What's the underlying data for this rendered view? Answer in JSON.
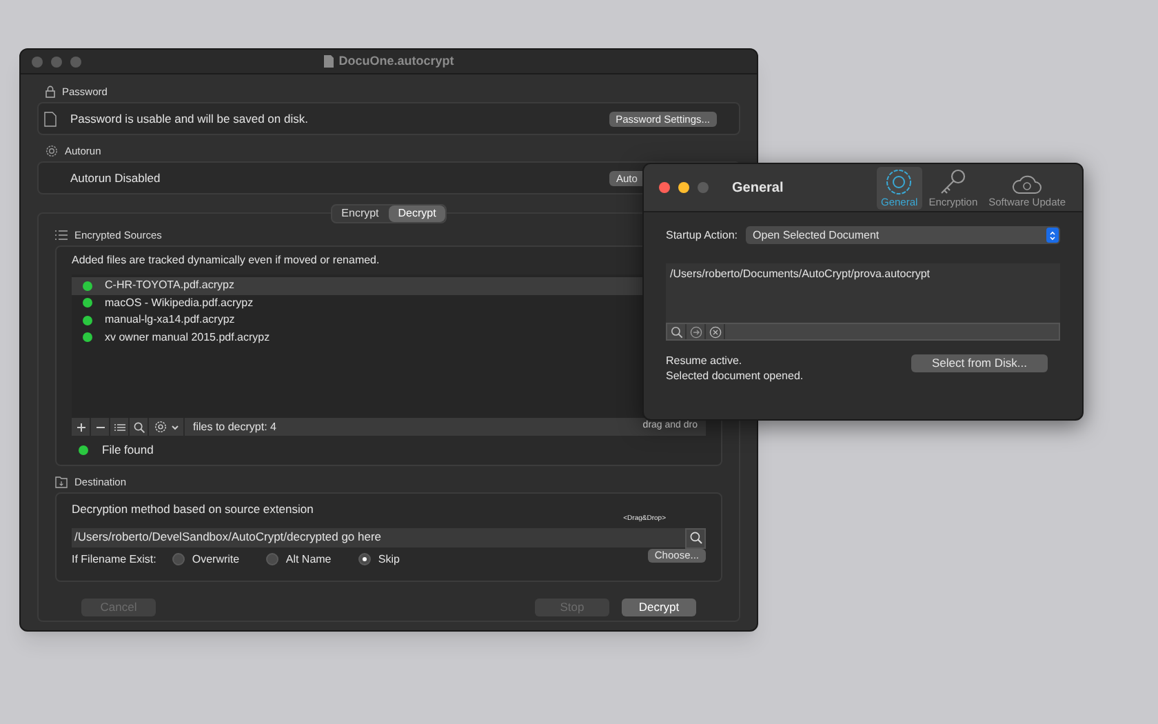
{
  "main_window": {
    "title": "DocuOne.autocrypt",
    "password": {
      "heading": "Password",
      "message": "Password is usable and will be saved on disk.",
      "button": "Password Settings..."
    },
    "autorun": {
      "heading": "Autorun",
      "message": "Autorun Disabled",
      "button": "Auto"
    },
    "mode_tabs": [
      {
        "label": "Encrypt",
        "selected": false
      },
      {
        "label": "Decrypt",
        "selected": true
      }
    ],
    "sources": {
      "heading": "Encrypted Sources",
      "note": "Added files are tracked dynamically  even if moved or renamed.",
      "files": [
        {
          "name": "C-HR-TOYOTA.pdf.acrypz",
          "selected": true,
          "color": "#2ac840"
        },
        {
          "name": "macOS - Wikipedia.pdf.acrypz",
          "selected": false,
          "color": "#2ac840"
        },
        {
          "name": "manual-lg-xa14.pdf.acrypz",
          "selected": false,
          "color": "#2ac840"
        },
        {
          "name": "xv owner manual 2015.pdf.acrypz",
          "selected": false,
          "color": "#2ac840"
        }
      ],
      "count": "files to decrypt: 4",
      "drop_hint": "drag and dro",
      "status": {
        "text": "File found",
        "color": "#2ac840"
      }
    },
    "destination": {
      "heading": "Destination",
      "note": "Decryption method based on source extension",
      "drop_label": "<Drag&Drop>",
      "path": "/Users/roberto/DevelSandbox/AutoCrypt/decrypted go here",
      "choose_button": "Choose...",
      "exists_label": "If Filename Exist:",
      "options": [
        {
          "label": "Overwrite",
          "selected": false
        },
        {
          "label": "Alt Name",
          "selected": false
        },
        {
          "label": "Skip",
          "selected": true
        }
      ]
    },
    "buttons": [
      {
        "label": "Cancel",
        "disabled": true
      },
      {
        "label": "Stop",
        "disabled": true
      },
      {
        "label": "Decrypt",
        "disabled": false
      }
    ]
  },
  "prefs_window": {
    "title": "General",
    "tabs": [
      {
        "label": "General",
        "selected": true
      },
      {
        "label": "Encryption",
        "selected": false
      },
      {
        "label": "Software Update",
        "selected": false
      }
    ],
    "startup_label": "Startup Action:",
    "startup_value": "Open Selected Document",
    "document_path": "/Users/roberto/Documents/AutoCrypt/prova.autocrypt",
    "status_lines": [
      "Resume active.",
      "Selected document opened."
    ],
    "select_button": "Select from Disk..."
  }
}
